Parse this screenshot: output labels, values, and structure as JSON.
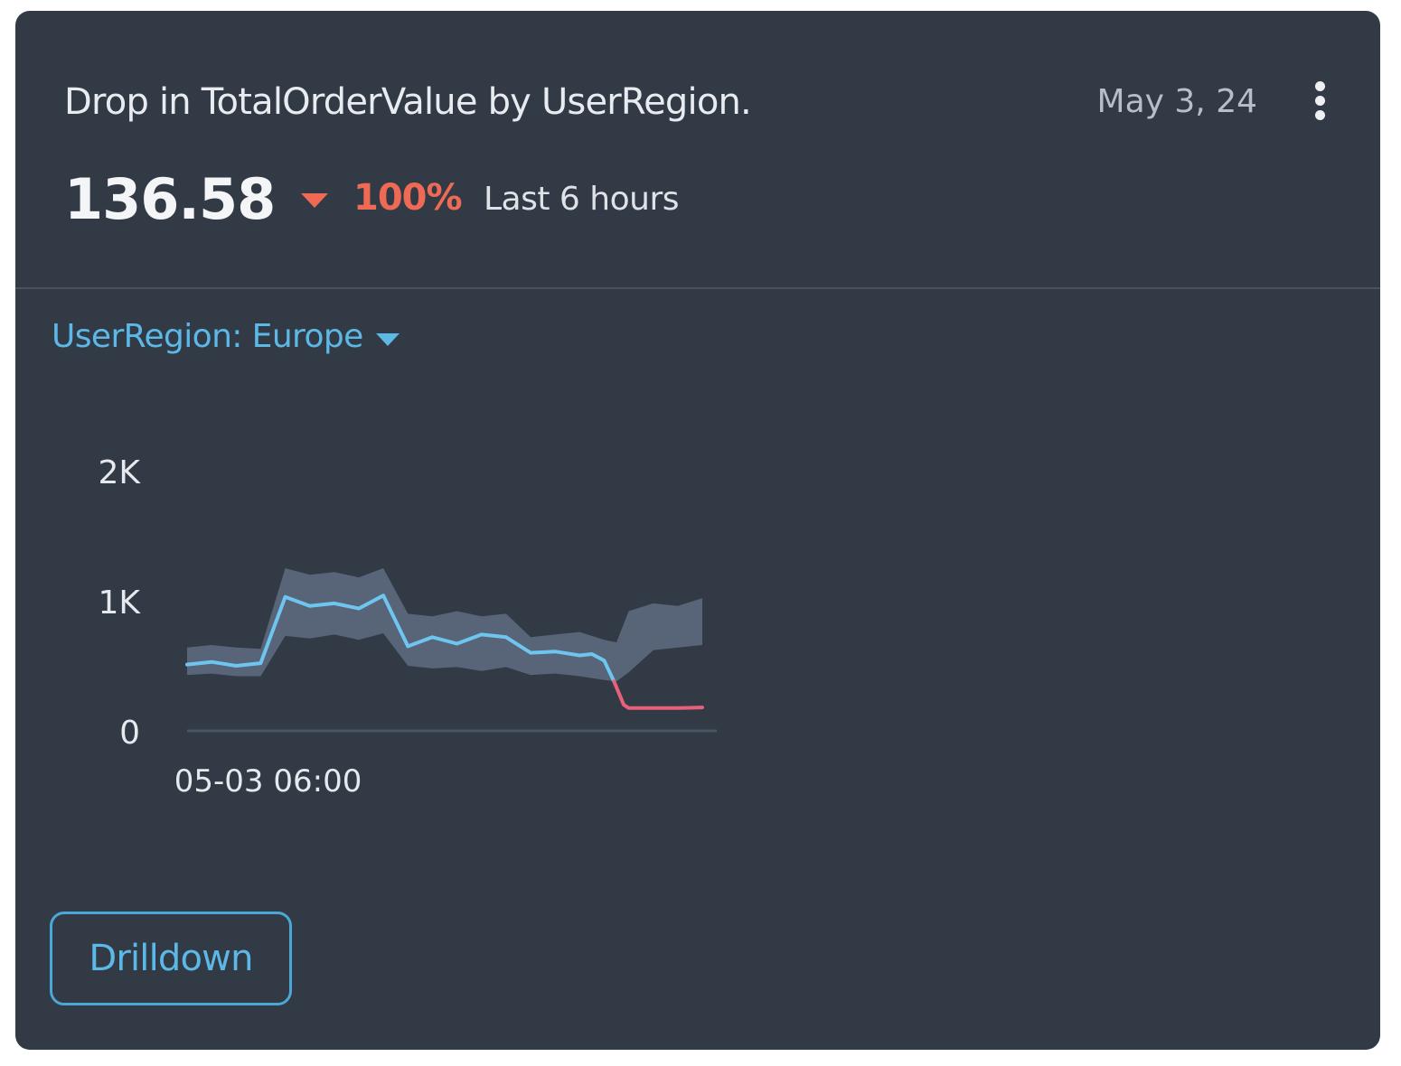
{
  "card": {
    "title": "Drop in TotalOrderValue by UserRegion.",
    "date": "May 3, 24",
    "menu_icon": "more-vertical-icon",
    "metric_value": "136.58",
    "change_icon": "triangle-down-icon",
    "change_pct": "100%",
    "period": "Last 6 hours"
  },
  "filter": {
    "label": "UserRegion: Europe",
    "caret_icon": "caret-down-icon"
  },
  "actions": {
    "drilldown_label": "Drilldown"
  },
  "colors": {
    "card_bg": "#323a46",
    "line_normal": "#6ec6f0",
    "band": "#5f6c80",
    "line_anomaly": "#e8607a",
    "drop_red": "#ee6a55",
    "accent": "#5cb8e6"
  },
  "chart_data": {
    "type": "line",
    "ylim": [
      0,
      2000
    ],
    "y_ticks": [
      {
        "value": 0,
        "label": "0"
      },
      {
        "value": 1000,
        "label": "1K"
      },
      {
        "value": 2000,
        "label": "2K"
      }
    ],
    "x_ticks": [
      {
        "value": 3.3,
        "label": "05-03 06:00"
      }
    ],
    "xlim": [
      0,
      21
    ],
    "series": [
      {
        "role": "expected-band",
        "x": [
          0,
          1,
          2,
          3,
          4,
          5,
          6,
          7,
          8,
          9,
          10,
          11,
          12,
          13,
          14,
          15,
          16,
          17,
          17.5,
          18,
          19,
          20,
          21
        ],
        "upper": [
          640,
          660,
          640,
          630,
          1250,
          1200,
          1220,
          1180,
          1250,
          900,
          880,
          920,
          880,
          900,
          720,
          740,
          760,
          700,
          680,
          920,
          980,
          960,
          1020
        ],
        "lower": [
          430,
          440,
          420,
          420,
          730,
          710,
          740,
          700,
          750,
          500,
          480,
          490,
          460,
          490,
          430,
          440,
          420,
          390,
          380,
          450,
          620,
          640,
          660
        ]
      },
      {
        "role": "actual-normal",
        "x": [
          0,
          1,
          2,
          3,
          4,
          5,
          6,
          7,
          8,
          9,
          10,
          11,
          12,
          13,
          14,
          15,
          16,
          16.5,
          17,
          17.4
        ],
        "values": [
          510,
          530,
          500,
          520,
          1030,
          960,
          980,
          940,
          1040,
          650,
          720,
          670,
          740,
          720,
          600,
          610,
          580,
          590,
          540,
          380
        ]
      },
      {
        "role": "actual-anomaly",
        "x": [
          17.4,
          17.8,
          18,
          19,
          20,
          21
        ],
        "values": [
          380,
          200,
          175,
          175,
          175,
          180
        ]
      }
    ]
  }
}
